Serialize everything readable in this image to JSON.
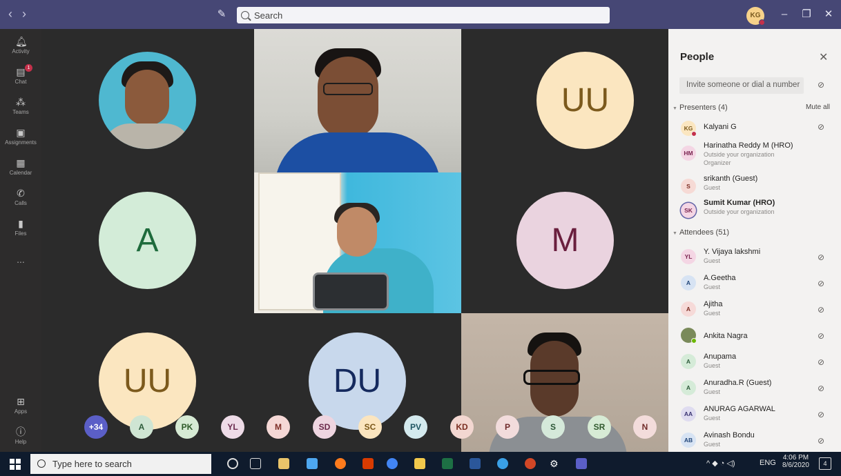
{
  "titlebar": {
    "search_placeholder": "Search",
    "back_icon": "chevron-left-icon",
    "forward_icon": "chevron-right-icon",
    "compose_icon": "compose-icon",
    "user_initials": "KG",
    "minimize": "–",
    "maximize": "❐",
    "close": "✕",
    "color": "#464775"
  },
  "rail": {
    "items": [
      {
        "label": "Activity",
        "icon": "bell-icon"
      },
      {
        "label": "Chat",
        "icon": "chat-icon",
        "badge": "1"
      },
      {
        "label": "Teams",
        "icon": "teams-icon"
      },
      {
        "label": "Assignments",
        "icon": "assignments-icon"
      },
      {
        "label": "Calendar",
        "icon": "calendar-icon"
      },
      {
        "label": "Calls",
        "icon": "phone-icon"
      },
      {
        "label": "Files",
        "icon": "files-icon"
      },
      {
        "label": "...",
        "icon": "more-icon"
      }
    ],
    "bottom": [
      {
        "label": "Apps",
        "icon": "apps-icon"
      },
      {
        "label": "Help",
        "icon": "help-icon"
      }
    ]
  },
  "grid": {
    "tiles": [
      {
        "initials": "UU",
        "bg": "#fbe6c0",
        "color": "#7c5a1d"
      },
      {
        "initials": "A",
        "bg": "#d3ecd8",
        "color": "#1e6b3c"
      },
      {
        "initials": "M",
        "bg": "#ead3df",
        "color": "#6a1f3e"
      },
      {
        "initials": "UU",
        "bg": "#fbe6c0",
        "color": "#7c5a1d"
      },
      {
        "initials": "DU",
        "bg": "#c8d8ec",
        "color": "#152a5e"
      }
    ]
  },
  "strip": [
    {
      "initials": "+34",
      "bg": "#5b5fc7",
      "color": "#ffffff"
    },
    {
      "initials": "A",
      "bg": "#cfe5d3",
      "color": "#2d5b3a"
    },
    {
      "initials": "PK",
      "bg": "#d6ead4",
      "color": "#2e5a2a"
    },
    {
      "initials": "YL",
      "bg": "#eedbe7",
      "color": "#6a2b4f"
    },
    {
      "initials": "M",
      "bg": "#f5d8d6",
      "color": "#7c2d26"
    },
    {
      "initials": "SD",
      "bg": "#eed5e0",
      "color": "#6a2749"
    },
    {
      "initials": "SC",
      "bg": "#fbe5bf",
      "color": "#7a5718"
    },
    {
      "initials": "PV",
      "bg": "#d4eaee",
      "color": "#1f5662"
    },
    {
      "initials": "KD",
      "bg": "#f3d7d1",
      "color": "#7a2e21"
    },
    {
      "initials": "P",
      "bg": "#f2dcdc",
      "color": "#6e2a2a"
    },
    {
      "initials": "S",
      "bg": "#d5e9da",
      "color": "#2c5636"
    },
    {
      "initials": "SR",
      "bg": "#d7ebd5",
      "color": "#30592d"
    },
    {
      "initials": "N",
      "bg": "#f3dcdb",
      "color": "#712c29"
    }
  ],
  "panel": {
    "title": "People",
    "invite_placeholder": "Invite someone or dial a number",
    "presenters_label": "Presenters (4)",
    "mute_all": "Mute all",
    "attendees_label": "Attendees (51)",
    "presenters": [
      {
        "initials": "KG",
        "name": "Kalyani G",
        "sub": "",
        "sub2": "",
        "bg": "#fbe6c0",
        "color": "#7c5a1d",
        "bold": false,
        "mic": true
      },
      {
        "initials": "HM",
        "name": "Harinatha Reddy M (HRO)",
        "sub": "Outside your organization",
        "sub2": "Organizer",
        "bg": "#f4d6e4",
        "color": "#7a2450",
        "bold": false,
        "mic": false
      },
      {
        "initials": "S",
        "name": "srikanth (Guest)",
        "sub": "Guest",
        "sub2": "",
        "bg": "#f6dad5",
        "color": "#7c2e24",
        "bold": false,
        "mic": false
      },
      {
        "initials": "SK",
        "name": "Sumit Kumar (HRO)",
        "sub": "Outside your organization",
        "sub2": "",
        "bg": "#f4d6e4",
        "color": "#7a2450",
        "bold": true,
        "mic": false
      }
    ],
    "attendees": [
      {
        "initials": "YL",
        "name": "Y. Vijaya lakshmi",
        "sub": "Guest",
        "bg": "#f4d6e4",
        "color": "#7a2450"
      },
      {
        "initials": "A",
        "name": "A.Geetha",
        "sub": "Guest",
        "bg": "#d7e3f3",
        "color": "#23477a"
      },
      {
        "initials": "A",
        "name": "Ajitha",
        "sub": "Guest",
        "bg": "#f6dad8",
        "color": "#7c2e24"
      },
      {
        "initials": "",
        "name": "Ankita Nagra",
        "sub": "",
        "bg": "#7a8a5a",
        "color": "#ffffff"
      },
      {
        "initials": "A",
        "name": "Anupama",
        "sub": "Guest",
        "bg": "#d5ebd8",
        "color": "#2d5b3a"
      },
      {
        "initials": "A",
        "name": "Anuradha.R (Guest)",
        "sub": "Guest",
        "bg": "#d5ebd8",
        "color": "#2d5b3a"
      },
      {
        "initials": "AA",
        "name": "ANURAG AGARWAL",
        "sub": "Guest",
        "bg": "#dfdcf0",
        "color": "#3b3573"
      },
      {
        "initials": "AB",
        "name": "Avinash Bondu",
        "sub": "Guest",
        "bg": "#d7e3f3",
        "color": "#23477a"
      }
    ]
  },
  "taskbar": {
    "search_placeholder": "Type here to search",
    "tray_lang": "ENG",
    "time": "4:06 PM",
    "date": "8/6/2020",
    "notification_count": "4"
  }
}
